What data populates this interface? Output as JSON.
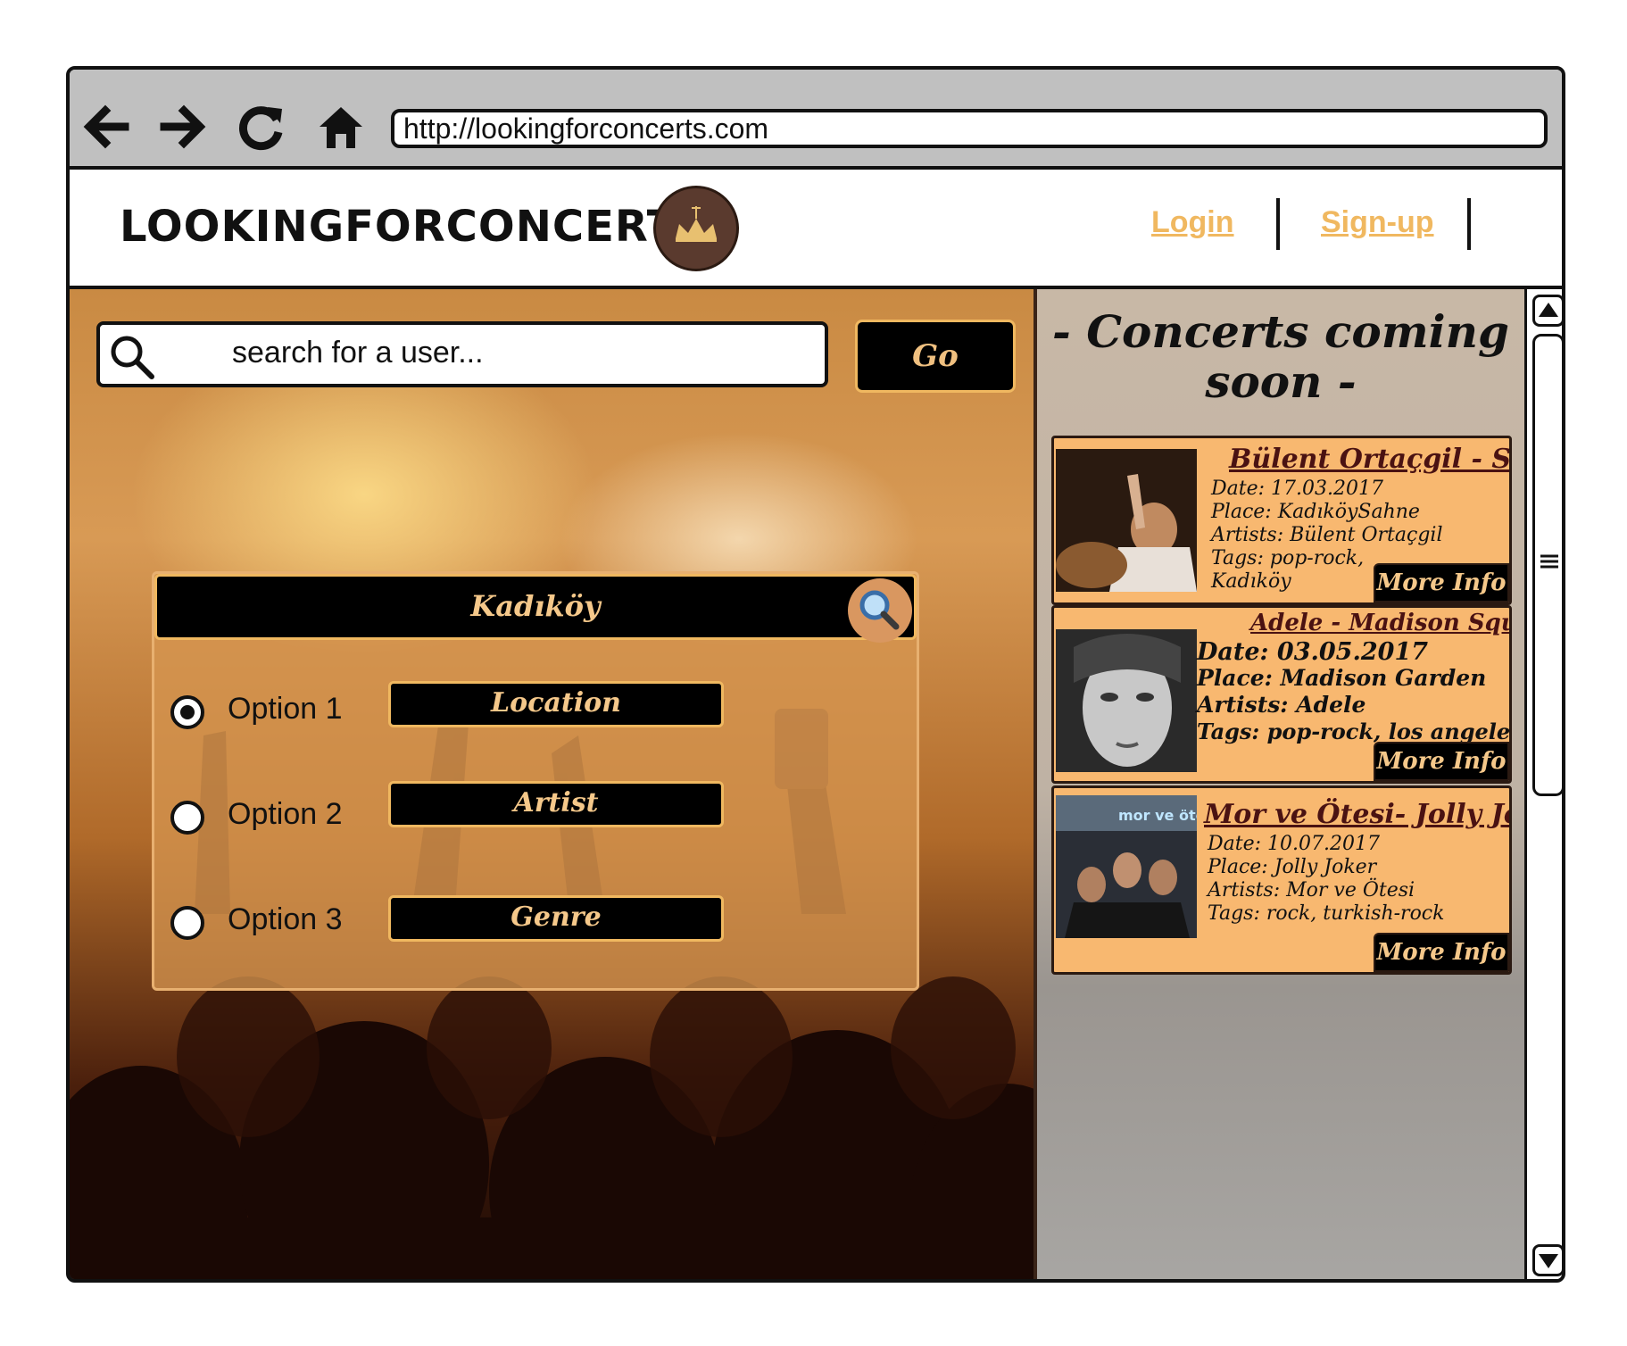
{
  "browser": {
    "url": "http://lookingforconcerts.com",
    "nav_icons": [
      "back-arrow-icon",
      "forward-arrow-icon",
      "reload-icon",
      "home-icon"
    ]
  },
  "header": {
    "site_title": "LOOKINGFORCONCERTS",
    "login_label": "Login",
    "signup_label": "Sign-up"
  },
  "search": {
    "placeholder": "search for a user...",
    "go_label": "Go"
  },
  "filter": {
    "location_value": "Kadıköy",
    "options": [
      {
        "label": "Option 1",
        "button": "Location",
        "checked": true
      },
      {
        "label": "Option 2",
        "button": "Artist",
        "checked": false
      },
      {
        "label": "Option 3",
        "button": "Genre",
        "checked": false
      }
    ]
  },
  "sidebar": {
    "title_line1": "- Concerts coming",
    "title_line2": "soon -",
    "concerts": [
      {
        "title": "Bülent Ortaçgil - Sen",
        "date": "Date: 17.03.2017",
        "place": "Place:  KadıköySahne",
        "artists": "Artists: Bülent Ortaçgil",
        "tags": "Tags: pop-rock,",
        "tags2": " Kadıköy",
        "more": "More Info"
      },
      {
        "title": "Adele - Madison Square",
        "date": "Date: 03.05.2017",
        "place": "Place: Madison Garden",
        "artists": "Artists: Adele",
        "tags": "Tags: pop-rock, los angeles",
        "more": "More Info"
      },
      {
        "title": "Mor ve Ötesi- Jolly Joker",
        "date": "Date: 10.07.2017",
        "place": "Place:  Jolly Joker",
        "artists": "Artists: Mor ve Ötesi",
        "tags": "Tags: rock, turkish-rock",
        "more": "More Info",
        "image_caption": "mor ve ötesi"
      }
    ]
  },
  "colors": {
    "accent": "#f0b860",
    "card_bg": "#f8b870",
    "button_bg": "#000000"
  }
}
